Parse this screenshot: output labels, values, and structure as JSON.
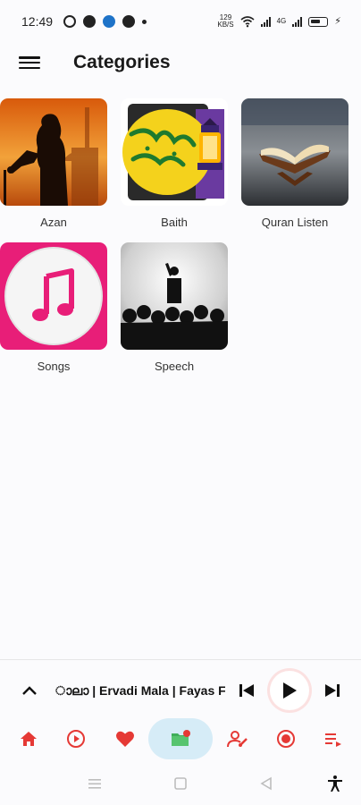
{
  "status_bar": {
    "time": "12:49",
    "net_speed_top": "129",
    "net_speed_bottom": "KB/S",
    "net_type": "4G",
    "icons": [
      "whatsapp-icon",
      "shazam-icon",
      "app-icon",
      "settings-icon",
      "notification-dot-icon",
      "wifi-icon",
      "signal-icon",
      "battery-icon",
      "charging-icon"
    ]
  },
  "header": {
    "title": "Categories",
    "menu_icon": "hamburger-menu-icon"
  },
  "categories": [
    {
      "label": "Azan",
      "image": "minaret-silhouette-illustration"
    },
    {
      "label": "Baith",
      "image": "arabic-calligraphy-lantern-illustration"
    },
    {
      "label": "Quran Listen",
      "image": "open-book-on-stand-illustration"
    },
    {
      "label": "Songs",
      "image": "music-note-illustration"
    },
    {
      "label": "Speech",
      "image": "speaker-crowd-illustration"
    }
  ],
  "player": {
    "track_title": "ാലാ | Ervadi Mala | Fayas F",
    "expand_icon": "chevron-up-icon",
    "prev_icon": "skip-previous-icon",
    "play_icon": "play-icon",
    "next_icon": "skip-next-icon"
  },
  "bottom_nav": {
    "items": [
      "home-icon",
      "play-circle-icon",
      "favorite-icon",
      "folder-icon",
      "artist-icon",
      "radio-icon",
      "playlist-icon"
    ],
    "active_index": 3
  },
  "colors": {
    "accent": "#e53935",
    "active_tab_bg": "#d6ecf7",
    "folder_green": "#3fae5a"
  }
}
